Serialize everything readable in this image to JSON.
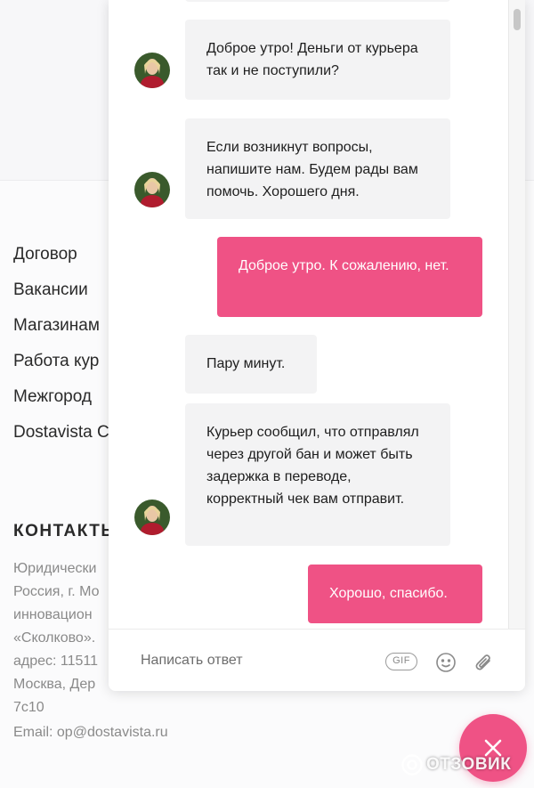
{
  "site": {
    "footer_nav": [
      "Договор",
      "Вакансии",
      "Магазинам",
      "Работа кур",
      "Межгород",
      "Dostavista С"
    ],
    "contacts": {
      "title": "КОНТАКТЫ",
      "lines": [
        "Юридически",
        "Россия, г. Мо",
        "инновацион",
        "«Сколково».",
        "адрес: 11511",
        "Москва, Дер",
        "7с10"
      ],
      "email": "Email: op@dostavista.ru"
    }
  },
  "chat": {
    "messages": [
      {
        "direction": "in",
        "avatar": true,
        "text": "Доброе утро! Деньги от курьера так и не поступили?"
      },
      {
        "direction": "in",
        "avatar": true,
        "text": "Если возникнут вопросы, напишите нам. Будем рады вам помочь. Хорошего дня."
      },
      {
        "direction": "out",
        "avatar": false,
        "text": "Доброе утро. К сожалению, нет."
      },
      {
        "direction": "in",
        "avatar": false,
        "text": "Пару минут."
      },
      {
        "direction": "in",
        "avatar": true,
        "text": "Курьер сообщил, что отправлял через другой бан и может быть задержка в переводе, корректный чек вам отправит."
      },
      {
        "direction": "out",
        "avatar": false,
        "text": "Хорошо, спасибо."
      }
    ],
    "composer": {
      "placeholder": "Написать ответ",
      "gif_label": "GIF",
      "emoji_icon": "smiley-icon",
      "attach_icon": "paperclip-icon"
    }
  },
  "launcher": {
    "icon": "close-icon"
  },
  "watermark": {
    "text": "ОТЗОВИК"
  },
  "colors": {
    "accent": "#ef5285",
    "incoming_bubble": "#f3f3f4",
    "muted_text": "#8a8a8a"
  }
}
